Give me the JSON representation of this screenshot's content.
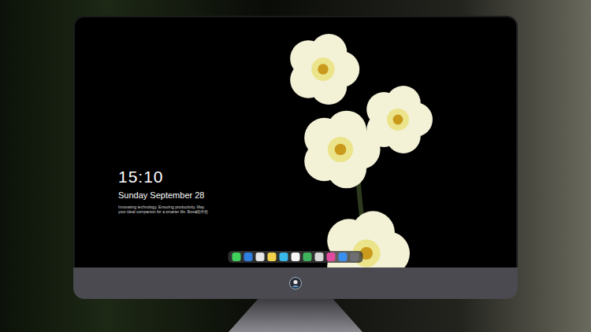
{
  "desktop": {
    "time": "15:10",
    "date": "Sunday September 28",
    "tagline": "Innovating technology, Ensuring productivity. May your ideal companion for a smarter life. Bova陪伴您"
  },
  "dock": {
    "items": [
      {
        "color": "#3fcf5a"
      },
      {
        "color": "#2f7fe0"
      },
      {
        "color": "#e6e6e6"
      },
      {
        "color": "#f2d24a"
      },
      {
        "color": "#39b8ec"
      },
      {
        "color": "#f5f5f5"
      },
      {
        "color": "#3fb15b"
      },
      {
        "color": "#d8d8d8"
      },
      {
        "color": "#e04aa0"
      },
      {
        "color": "#3a8ef0"
      },
      {
        "color": "#6e6e73"
      }
    ]
  }
}
